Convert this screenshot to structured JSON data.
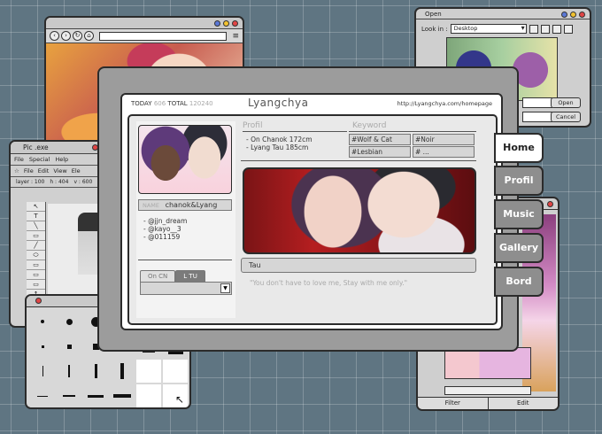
{
  "browser": {
    "nav_back": "‹",
    "nav_forward": "›",
    "nav_reload": "↻",
    "nav_home": "⌂",
    "menu_icon": "≡"
  },
  "open_dialog": {
    "title": "Open",
    "look_in_label": "Look in :",
    "look_in_value": "Desktop",
    "open_button": "Open",
    "cancel_button": "Cancel"
  },
  "paint": {
    "title": "Pic .exe",
    "menu": [
      "File",
      "Special",
      "Help"
    ],
    "menu2": [
      "File",
      "Edit",
      "View",
      "Ele"
    ],
    "layer": "layer : 100",
    "height": "h : 404",
    "v": "v : 600",
    "tools": [
      "↖",
      "T",
      "╲",
      "▭",
      "╱",
      "⬭",
      "▭",
      "▭",
      "▭",
      "↑",
      "▭",
      "✎",
      "■"
    ]
  },
  "gallery": {
    "filter_label": "Filter",
    "edit_label": "Edit"
  },
  "main": {
    "today_label": "TODAY",
    "today_value": "606",
    "total_label": "TOTAL",
    "total_value": "120240",
    "site_title": "Lyangchya",
    "url": "http://Lyangchya.com/homepage",
    "name_label": "NAME",
    "name_value": "chanok&Lyang",
    "handles": [
      "- @jjn_dream",
      "- @kayo__3",
      "- @011159"
    ],
    "tab_on": "On CN",
    "tab_off": "L TU",
    "profile_label": "Profil",
    "profile_lines": [
      "- On Chanok 172cm",
      "- Lyang Tau 185cm"
    ],
    "keyword_label": "Keyword",
    "keywords": [
      "#Wolf & Cat",
      "#Noir",
      "#Lesbian",
      "# ..."
    ],
    "caption": "Tau",
    "quote": "\"You don't have to love me, Stay with me only.\"",
    "nav": [
      "Home",
      "Profil",
      "Music",
      "Gallery",
      "Bord"
    ]
  }
}
